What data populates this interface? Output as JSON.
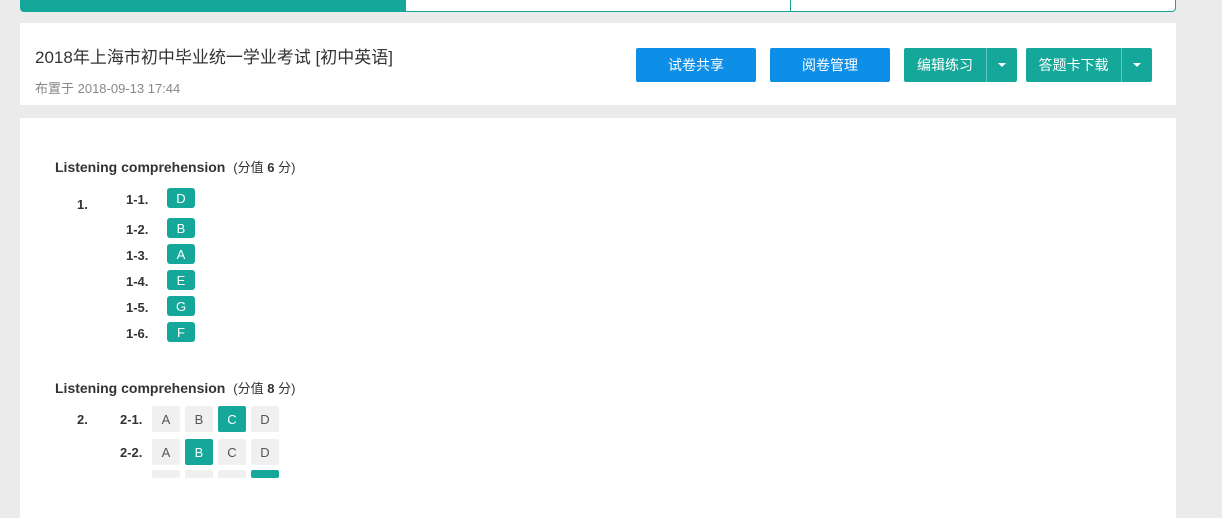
{
  "header": {
    "title": "2018年上海市初中毕业统一学业考试 [初中英语]",
    "subtitle": "布置于 2018-09-13 17:44",
    "buttons": {
      "share": "试卷共享",
      "review": "阅卷管理",
      "edit": "编辑练习",
      "download": "答题卡下载"
    }
  },
  "sections": [
    {
      "title": "Listening comprehension",
      "score_prefix": "(分值",
      "score": "6",
      "score_suffix": "分)",
      "number": "1.",
      "items": [
        {
          "label": "1-1.",
          "answer": "D"
        },
        {
          "label": "1-2.",
          "answer": "B"
        },
        {
          "label": "1-3.",
          "answer": "A"
        },
        {
          "label": "1-4.",
          "answer": "E"
        },
        {
          "label": "1-5.",
          "answer": "G"
        },
        {
          "label": "1-6.",
          "answer": "F"
        }
      ]
    },
    {
      "title": "Listening comprehension",
      "score_prefix": "(分值",
      "score": "8",
      "score_suffix": "分)",
      "number": "2.",
      "options": [
        "A",
        "B",
        "C",
        "D"
      ],
      "items": [
        {
          "label": "2-1.",
          "selected": "C"
        },
        {
          "label": "2-2.",
          "selected": "B"
        }
      ]
    }
  ],
  "colors": {
    "teal": "#15a799",
    "blue": "#0d8fe8"
  }
}
